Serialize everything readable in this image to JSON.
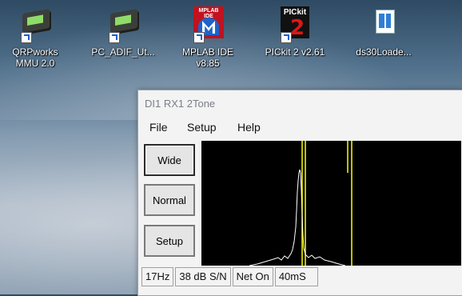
{
  "desktop": {
    "icons": [
      {
        "label_line1": "QRPworks",
        "label_line2": "MMU 2.0",
        "icon": "device-icon"
      },
      {
        "label_line1": "PC_ADIF_Ut...",
        "label_line2": "",
        "icon": "device-icon"
      },
      {
        "label_line1": "MPLAB IDE",
        "label_line2": "v8.85",
        "icon": "mplab-icon",
        "icon_text": "MPLAB IDE"
      },
      {
        "label_line1": "PICkit 2 v2.61",
        "label_line2": "",
        "icon": "pickit-icon",
        "icon_text": "PICkit",
        "icon_number": "2"
      },
      {
        "label_line1": "ds30Loade...",
        "label_line2": "",
        "icon": "document-icon"
      }
    ]
  },
  "window": {
    "title": "DI1 RX1 2Tone",
    "menu": [
      "File",
      "Setup",
      "Help"
    ],
    "buttons": {
      "wide": "Wide",
      "normal": "Normal",
      "setup": "Setup"
    },
    "status": [
      "17Hz",
      "38 dB S/N",
      "Net On",
      "40mS"
    ]
  },
  "colors": {
    "accent_line": "#ffff00",
    "spectrum": "#ffffff",
    "plot_bg": "#000000"
  }
}
